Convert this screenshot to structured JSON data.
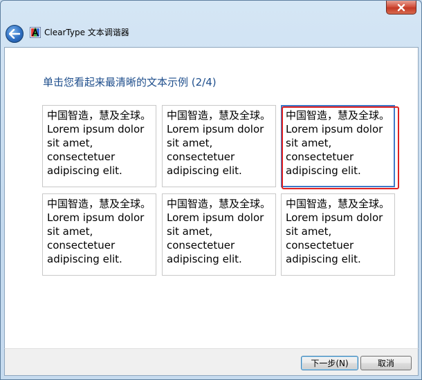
{
  "window": {
    "title": "ClearType 文本调谐器"
  },
  "main": {
    "heading": "单击您看起来最清晰的文本示例 (2/4)",
    "samples": [
      {
        "lines": [
          "中国智造，慧及全球。",
          "Lorem ipsum dolor",
          "sit amet,",
          "consectetuer",
          "adipiscing elit."
        ]
      },
      {
        "lines": [
          "中国智造，慧及全球。",
          "Lorem ipsum dolor",
          "sit amet,",
          "consectetuer",
          "adipiscing elit."
        ]
      },
      {
        "lines": [
          "中国智造，慧及全球。",
          "Lorem ipsum dolor",
          "sit amet,",
          "consectetuer",
          "adipiscing elit."
        ]
      },
      {
        "lines": [
          "中国智造，慧及全球。",
          "Lorem ipsum dolor",
          "sit amet,",
          "consectetuer",
          "adipiscing elit."
        ]
      },
      {
        "lines": [
          "中国智造，慧及全球。",
          "Lorem ipsum dolor",
          "sit amet,",
          "consectetuer",
          "adipiscing elit."
        ]
      },
      {
        "lines": [
          "中国智造，慧及全球。",
          "Lorem ipsum dolor",
          "sit amet,",
          "consectetuer",
          "adipiscing elit."
        ]
      }
    ],
    "selected_index": 2
  },
  "footer": {
    "next_label": "下一步(N)",
    "cancel_label": "取消"
  },
  "icons": {
    "back": "back-arrow-icon",
    "app": "cleartype-icon",
    "close": "close-icon"
  },
  "colors": {
    "heading": "#1e4e8c",
    "highlight": "#e02020",
    "selected_border": "#3d78c8"
  }
}
